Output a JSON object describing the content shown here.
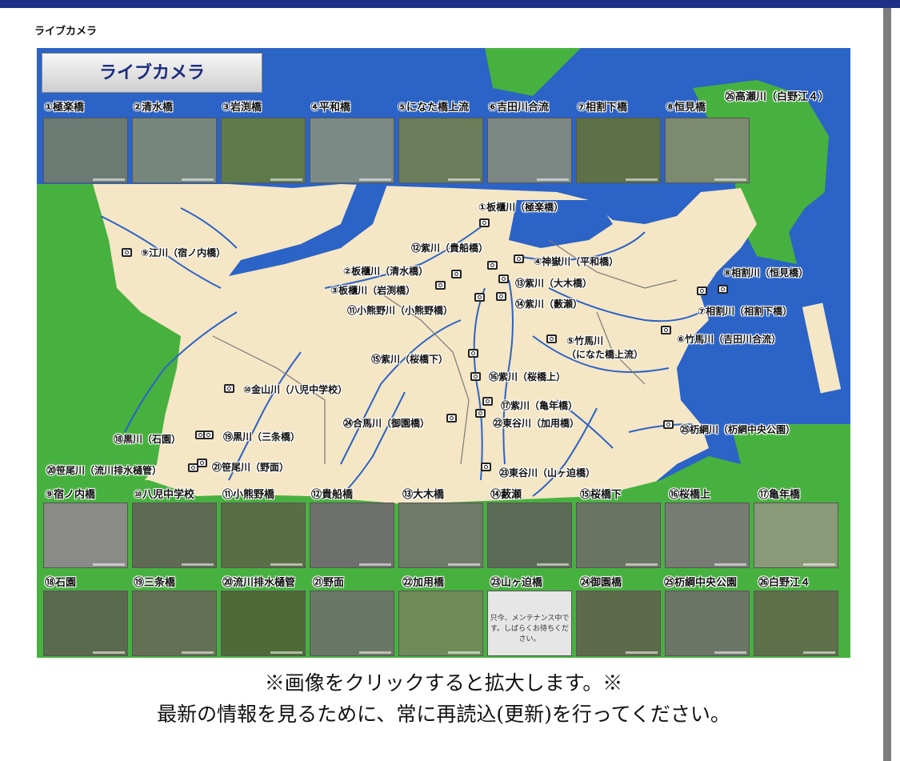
{
  "page": {
    "heading": "ライブカメラ"
  },
  "map": {
    "title_button": "ライブカメラ"
  },
  "top_row": [
    {
      "label": "①極楽橋",
      "tone": "#6c7a74"
    },
    {
      "label": "②清水橋",
      "tone": "#76867d"
    },
    {
      "label": "③岩渕橋",
      "tone": "#5f7a4a"
    },
    {
      "label": "④平和橋",
      "tone": "#7b8a84"
    },
    {
      "label": "⑤になた橋上流",
      "tone": "#6a7c5a"
    },
    {
      "label": "⑥吉田川合流",
      "tone": "#7c8683"
    },
    {
      "label": "⑦相割下橋",
      "tone": "#5d7048"
    },
    {
      "label": "⑧恒見橋",
      "tone": "#7c8a6f"
    }
  ],
  "corner_label": "㉖高瀬川（白野江４）",
  "row2": [
    {
      "label": "⑨宿ノ内橋",
      "tone": "#8a8b86"
    },
    {
      "label": "⑩八児中学校",
      "tone": "#5e6b52"
    },
    {
      "label": "⑪小熊野橋",
      "tone": "#5a6e46"
    },
    {
      "label": "⑫貴船橋",
      "tone": "#6d706b"
    },
    {
      "label": "⑬大木橋",
      "tone": "#6f7a68"
    },
    {
      "label": "⑭藪瀬",
      "tone": "#5c6b55"
    },
    {
      "label": "⑮桜橋下",
      "tone": "#6a7462"
    },
    {
      "label": "⑯桜橋上",
      "tone": "#767b74"
    },
    {
      "label": "⑰亀年橋",
      "tone": "#8a9a78"
    }
  ],
  "row3": [
    {
      "label": "⑱石園",
      "tone": "#5b6a4c"
    },
    {
      "label": "⑲三条橋",
      "tone": "#637053"
    },
    {
      "label": "⑳流川排水樋管",
      "tone": "#4e6a37"
    },
    {
      "label": "㉑野面",
      "tone": "#6a7767"
    },
    {
      "label": "㉒加用橋",
      "tone": "#6f8b58"
    },
    {
      "label": "㉓山ヶ迫橋",
      "tone": "#e6e6e6"
    },
    {
      "label": "㉔御園橋",
      "tone": "#5e6b4a"
    },
    {
      "label": "㉕杤綱中央公園",
      "tone": "#6d7468"
    },
    {
      "label": "㉖白野江４",
      "tone": "#5d7049"
    }
  ],
  "maintenance_text": "只今、メンテナンス中です。しばらくお待ちください。",
  "locations": [
    {
      "text": "①板櫃川（極楽橋）"
    },
    {
      "text": "⑨江川（宿ノ内橋）"
    },
    {
      "text": "⑫紫川（貴船橋）"
    },
    {
      "text": "④神嶽川（平和橋）"
    },
    {
      "text": "②板櫃川（清水橋）"
    },
    {
      "text": "③板櫃川（岩渕橋）"
    },
    {
      "text": "⑬紫川（大木橋）"
    },
    {
      "text": "⑧相割川（恒見橋）"
    },
    {
      "text": "⑭紫川（藪瀬）"
    },
    {
      "text": "⑪小熊野川（小熊野橋）"
    },
    {
      "text": "⑦相割川（相割下橋）"
    },
    {
      "text": "⑤竹馬川"
    },
    {
      "text": "（になた橋上流）"
    },
    {
      "text": "⑥竹馬川（吉田川合流）"
    },
    {
      "text": "⑮紫川（桜橋下）"
    },
    {
      "text": "⑯紫川（桜橋上）"
    },
    {
      "text": "⑩金山川（八児中学校）"
    },
    {
      "text": "⑰紫川（亀年橋）"
    },
    {
      "text": "㉔合馬川（御園橋）"
    },
    {
      "text": "㉒東谷川（加用橋）"
    },
    {
      "text": "㉕杤網川（杤網中央公園）"
    },
    {
      "text": "⑱黒川（石園）"
    },
    {
      "text": "⑲黒川（三条橋）"
    },
    {
      "text": "⑳笹尾川（流川排水樋管）"
    },
    {
      "text": "㉑笹尾川（野面）"
    },
    {
      "text": "㉓東谷川（山ヶ迫橋）"
    }
  ],
  "footer": {
    "line1": "※画像をクリックすると拡大します。※",
    "line2": "最新の情報を見るために、常に再読込(更新)を行ってください。"
  },
  "colors": {
    "sea": "#2b63c6",
    "land": "#f5e6c5",
    "mountain": "#47b13f",
    "river": "#2b63c6",
    "header_bar": "#1f2f88"
  }
}
